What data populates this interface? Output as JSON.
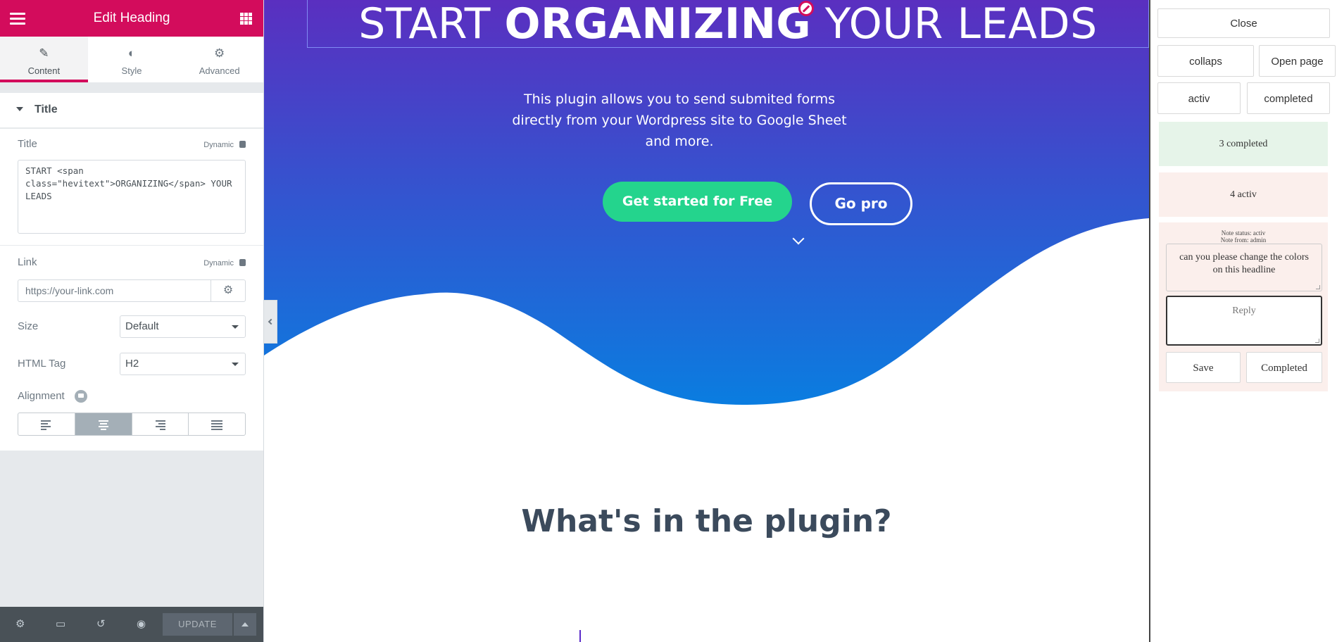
{
  "editor": {
    "header_title": "Edit Heading",
    "tabs": [
      {
        "label": "Content",
        "icon": "pencil-icon"
      },
      {
        "label": "Style",
        "icon": "half-circle-icon"
      },
      {
        "label": "Advanced",
        "icon": "gear-icon"
      }
    ],
    "active_tab": "Content",
    "section_title": "Title",
    "title_label": "Title",
    "dynamic_label": "Dynamic",
    "title_value": "START <span class=\"hevitext\">ORGANIZING</span> YOUR LEADS",
    "link_label": "Link",
    "link_placeholder": "https://your-link.com",
    "size_label": "Size",
    "size_value": "Default",
    "html_tag_label": "HTML Tag",
    "html_tag_value": "H2",
    "alignment_label": "Alignment",
    "alignment_active": "center",
    "update_label": "UPDATE",
    "accent_color": "#d30c5c"
  },
  "preview": {
    "headline_part1": "START ",
    "headline_bold": "ORGANIZING",
    "headline_part2": " YOUR LEADS",
    "subtext": "This plugin allows you to send submited forms directly from your Wordpress site to Google Sheet and more.",
    "primary_button": "Get started for Free",
    "secondary_button": "Go pro",
    "section_heading": "What's in the plugin?",
    "gradient_top": "#5a2fc0",
    "gradient_bottom": "#0a7de0",
    "primary_button_color": "#24d48d"
  },
  "notes_panel": {
    "close_label": "Close",
    "collaps_label": "collaps",
    "open_page_label": "Open page",
    "activ_label": "activ",
    "completed_label": "completed",
    "completed_count_label": "3 completed",
    "activ_count_label": "4 activ",
    "note_status": "Note status: activ",
    "note_from": "Note from: admin",
    "note_text": "can you please change the colors on this headline",
    "reply_placeholder": "Reply",
    "save_label": "Save",
    "mark_completed_label": "Completed"
  }
}
